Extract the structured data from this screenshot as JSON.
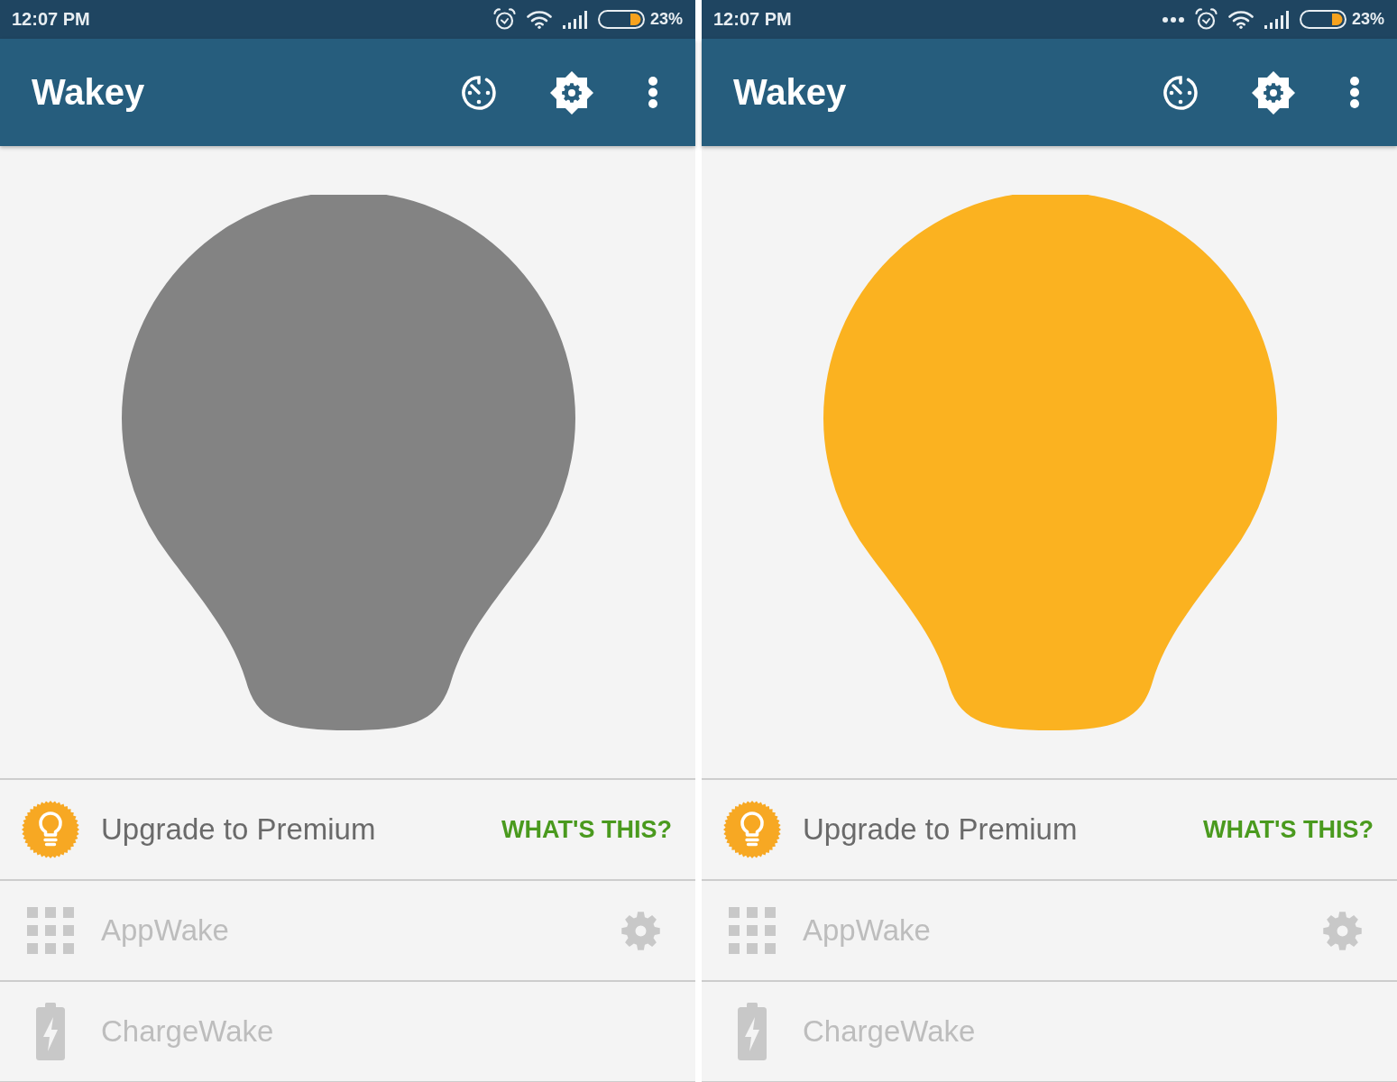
{
  "screens": [
    {
      "status_bar": {
        "time": "12:07 PM",
        "more_notifications": false,
        "battery": "23%"
      },
      "app_bar": {
        "title": "Wakey"
      },
      "bulb": {
        "on": false
      },
      "premium": {
        "label": "Upgrade to Premium",
        "link": "WHAT'S THIS?"
      },
      "features": [
        {
          "kind": "apps",
          "label": "AppWake",
          "disabled": true,
          "settings": true
        },
        {
          "kind": "charge",
          "label": "ChargeWake",
          "disabled": true,
          "settings": false
        }
      ]
    },
    {
      "status_bar": {
        "time": "12:07 PM",
        "more_notifications": true,
        "battery": "23%"
      },
      "app_bar": {
        "title": "Wakey"
      },
      "bulb": {
        "on": true
      },
      "premium": {
        "label": "Upgrade to Premium",
        "link": "WHAT'S THIS?"
      },
      "features": [
        {
          "kind": "apps",
          "label": "AppWake",
          "disabled": true,
          "settings": true
        },
        {
          "kind": "charge",
          "label": "ChargeWake",
          "disabled": true,
          "settings": false
        }
      ]
    }
  ]
}
